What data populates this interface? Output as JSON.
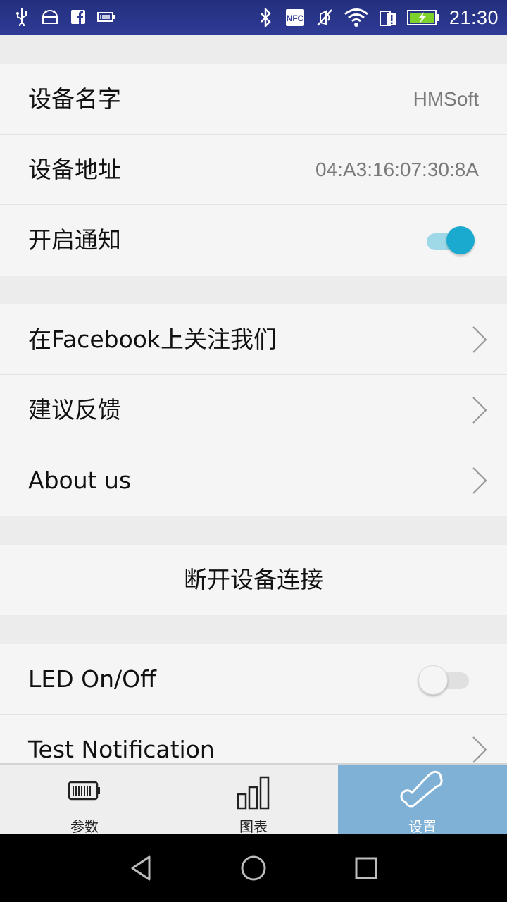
{
  "status_bar": {
    "time": "21:30",
    "left_icons": [
      "usb-icon",
      "android-icon",
      "facebook-icon",
      "battery-small-icon"
    ],
    "right_icons": [
      "bluetooth-icon",
      "nfc-icon",
      "vibrate-off-icon",
      "wifi-icon",
      "sim-alert-icon",
      "battery-charging-icon"
    ],
    "nfc_text": "NFC"
  },
  "device_info": {
    "name_label": "设备名字",
    "name_value": "HMSoft",
    "address_label": "设备地址",
    "address_value": "04:A3:16:07:30:8A",
    "notify_label": "开启通知",
    "notify_on": true
  },
  "links": {
    "facebook_label": "在Facebook上关注我们",
    "feedback_label": "建议反馈",
    "about_label": "About us"
  },
  "disconnect_label": "断开设备连接",
  "debug": {
    "led_label": "LED On/Off",
    "led_on": false,
    "test_label": "Test Notification"
  },
  "tabs": [
    {
      "label": "参数",
      "icon": "battery-icon",
      "active": false
    },
    {
      "label": "图表",
      "icon": "bar-chart-icon",
      "active": false
    },
    {
      "label": "设置",
      "icon": "bone-icon",
      "active": true
    }
  ],
  "accent_color": "#1aaad0",
  "tab_active_color": "#7fb1d6"
}
